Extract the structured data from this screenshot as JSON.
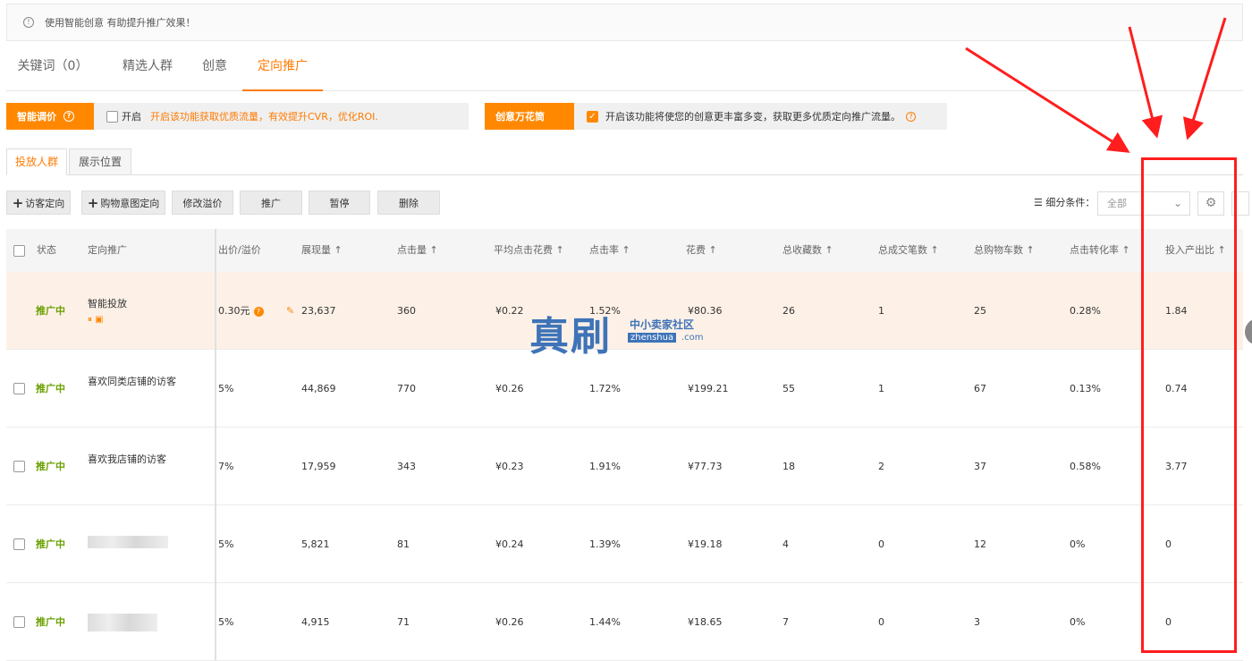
{
  "notice": {
    "text": "使用智能创意 有助提升推广效果！"
  },
  "main_tabs": [
    {
      "label": "关键词（0）"
    },
    {
      "label": "精选人群"
    },
    {
      "label": "创意"
    },
    {
      "label": "定向推广"
    }
  ],
  "smart_bid": {
    "button": "智能调价",
    "checkbox_label": "开启",
    "hint": "开启该功能获取优质流量，有效提升CVR，优化ROI."
  },
  "creative": {
    "button": "创意万花筒",
    "hint": "开启该功能将使您的创意更丰富多变，获取更多优质定向推广流量。"
  },
  "sub_tabs": [
    {
      "label": "投放人群"
    },
    {
      "label": "展示位置"
    }
  ],
  "toolbar": {
    "visitor_target": "访客定向",
    "purchase_intent": "购物意图定向",
    "modify_premium": "修改溢价",
    "promote": "推广",
    "pause": "暂停",
    "delete": "删除",
    "filter_label": "细分条件：",
    "filter_value": "全部"
  },
  "table": {
    "headers": {
      "status": "状态",
      "target": "定向推广",
      "bid": "出价/溢价",
      "impressions": "展现量 ↑",
      "clicks": "点击量 ↑",
      "avg_cpc": "平均点击花费 ↑",
      "ctr": "点击率 ↑",
      "cost": "花费 ↑",
      "favorites": "总收藏数 ↑",
      "orders": "总成交笔数 ↑",
      "carts": "总购物车数 ↑",
      "cvr": "点击转化率 ↑",
      "roi": "投入产出比 ↑"
    },
    "rows": [
      {
        "status": "推广中",
        "name": "智能投放",
        "bid": "0.30元",
        "impressions": "23,637",
        "clicks": "360",
        "avg_cpc": "¥0.22",
        "ctr": "1.52%",
        "cost": "¥80.36",
        "favorites": "26",
        "orders": "1",
        "carts": "25",
        "cvr": "0.28%",
        "roi": "1.84"
      },
      {
        "status": "推广中",
        "name": "喜欢同类店铺的访客",
        "bid": "5%",
        "impressions": "44,869",
        "clicks": "770",
        "avg_cpc": "¥0.26",
        "ctr": "1.72%",
        "cost": "¥199.21",
        "favorites": "55",
        "orders": "1",
        "carts": "67",
        "cvr": "0.13%",
        "roi": "0.74"
      },
      {
        "status": "推广中",
        "name": "喜欢我店铺的访客",
        "bid": "7%",
        "impressions": "17,959",
        "clicks": "343",
        "avg_cpc": "¥0.23",
        "ctr": "1.91%",
        "cost": "¥77.73",
        "favorites": "18",
        "orders": "2",
        "carts": "37",
        "cvr": "0.58%",
        "roi": "3.77"
      },
      {
        "status": "推广中",
        "name": "",
        "bid": "5%",
        "impressions": "5,821",
        "clicks": "81",
        "avg_cpc": "¥0.24",
        "ctr": "1.39%",
        "cost": "¥19.18",
        "favorites": "4",
        "orders": "0",
        "carts": "12",
        "cvr": "0%",
        "roi": "0"
      },
      {
        "status": "推广中",
        "name": "",
        "bid": "5%",
        "impressions": "4,915",
        "clicks": "71",
        "avg_cpc": "¥0.26",
        "ctr": "1.44%",
        "cost": "¥18.65",
        "favorites": "7",
        "orders": "0",
        "carts": "3",
        "cvr": "0%",
        "roi": "0"
      }
    ]
  },
  "watermark": {
    "big": "真刷",
    "small_cn": "中小卖家社区",
    "small_en": "zhenshua",
    "domain": ".com"
  },
  "colors": {
    "accent": "#ff7a00",
    "status_green": "#6aa000",
    "annotation_red": "#ff1d1d"
  }
}
